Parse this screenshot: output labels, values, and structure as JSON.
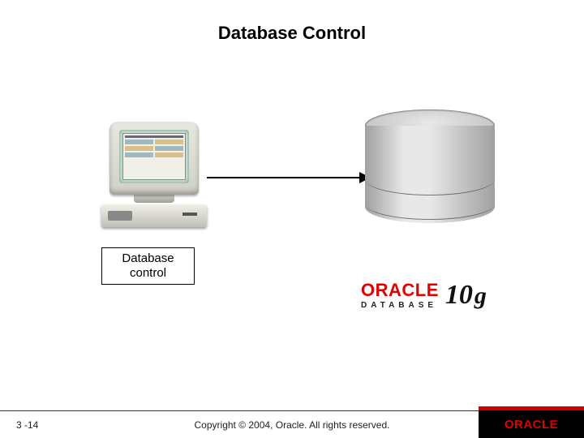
{
  "title": "Database Control",
  "diagram": {
    "label_line1": "Database",
    "label_line2": "control"
  },
  "product": {
    "brand": "ORACLE",
    "subline": "DATABASE",
    "version_num": "10",
    "version_suffix": "g"
  },
  "footer": {
    "page": "3 -14",
    "copyright": "Copyright © 2004, Oracle. All rights reserved.",
    "logo": "ORACLE"
  }
}
